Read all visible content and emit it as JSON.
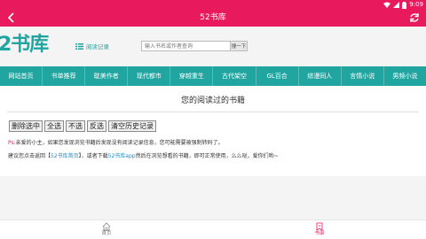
{
  "status": {
    "time": "9:09"
  },
  "topbar": {
    "title": "52书库"
  },
  "header": {
    "logo": "2书库",
    "reading_link": "阅读记录",
    "search_placeholder": "输入书名或作者查询",
    "search_button": "搜一下"
  },
  "nav": {
    "items": [
      "网站首页",
      "书单推荐",
      "耽美作者",
      "现代都市",
      "穿越重生",
      "古代架空",
      "GL百合",
      "综漫同人",
      "言情小说",
      "男频小说"
    ]
  },
  "page": {
    "title": "您的阅读过的书籍",
    "actions": [
      "删除选中",
      "全选",
      "不选",
      "反选",
      "清空历史记录"
    ],
    "notice1_prefix": "Ps:",
    "notice1_text": "亲爱的小主，如果您发现浏览书籍后发现没有阅读记录信息，您可能需要被强制转码了。",
    "notice2_a": "建议您点击返回【",
    "notice2_link1": "52书库首页",
    "notice2_b": "】，或者下载",
    "notice2_link2": "52书库app",
    "notice2_c": "然后在浏览想看的书籍，即可正常使用，么么哒，爱你们哟~"
  },
  "tabbar": {
    "home": "首页",
    "shelf": "书架"
  },
  "colors": {
    "brand_pink": "#e8195d",
    "brand_teal": "#20a5a0"
  },
  "icons": [
    "back-icon",
    "refresh-icon",
    "wifi-icon",
    "signal-icon",
    "battery-icon",
    "list-icon",
    "home-icon",
    "bookshelf-icon"
  ]
}
